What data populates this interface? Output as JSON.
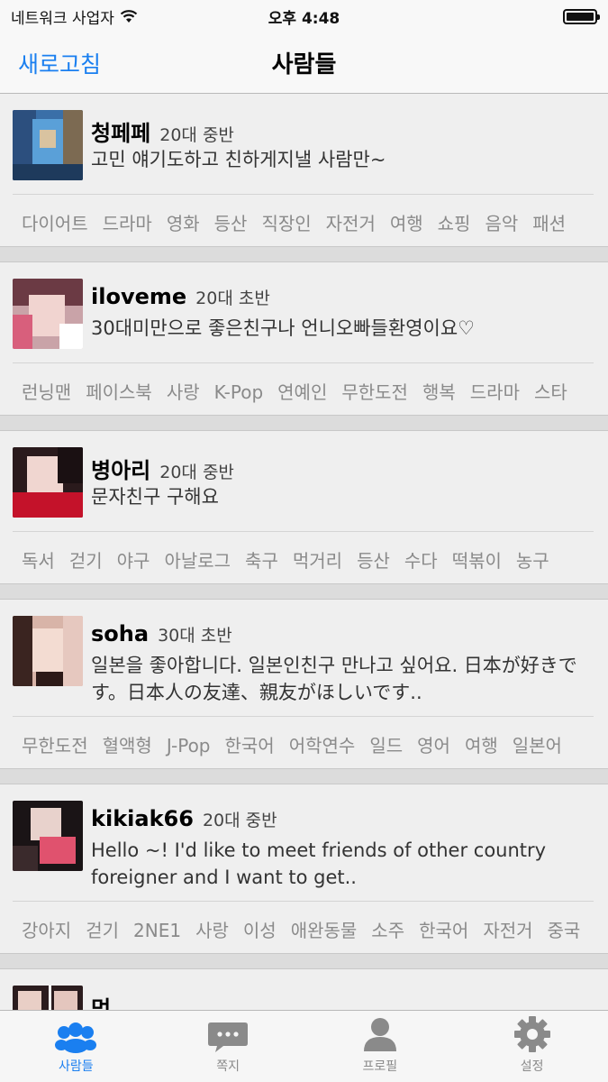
{
  "status_bar": {
    "carrier": "네트워크 사업자",
    "time": "오후 4:48"
  },
  "nav": {
    "left_button": "새로고침",
    "title": "사람들"
  },
  "people": [
    {
      "name": "청페페",
      "age": "20대 중반",
      "message": "고민 얘기도하고 친하게지낼 사람만~",
      "tags": [
        "다이어트",
        "드라마",
        "영화",
        "등산",
        "직장인",
        "자전거",
        "여행",
        "쇼핑",
        "음악",
        "패션"
      ]
    },
    {
      "name": "iloveme",
      "age": "20대 초반",
      "message": "30대미만으로 좋은친구나 언니오빠들환영이요♡",
      "tags": [
        "런닝맨",
        "페이스북",
        "사랑",
        "K-Pop",
        "연예인",
        "무한도전",
        "행복",
        "드라마",
        "스타"
      ]
    },
    {
      "name": "병아리",
      "age": "20대 중반",
      "message": "문자친구 구해요",
      "tags": [
        "독서",
        "걷기",
        "야구",
        "아날로그",
        "축구",
        "먹거리",
        "등산",
        "수다",
        "떡볶이",
        "농구"
      ]
    },
    {
      "name": "soha",
      "age": "30대 초반",
      "message": "일본을 좋아합니다. 일본인친구 만나고 싶어요. 日本が好きです。日本人の友達、親友がほしいです..",
      "tags": [
        "무한도전",
        "혈액형",
        "J-Pop",
        "한국어",
        "어학연수",
        "일드",
        "영어",
        "여행",
        "일본어"
      ]
    },
    {
      "name": "kikiak66",
      "age": "20대 중반",
      "message": "Hello ~! I'd like to meet friends of other country foreigner and I want to get..",
      "tags": [
        "강아지",
        "걷기",
        "2NE1",
        "사랑",
        "이성",
        "애완동물",
        "소주",
        "한국어",
        "자전거",
        "중국"
      ]
    },
    {
      "name": "멍",
      "age": "",
      "message": "",
      "tags": []
    }
  ],
  "tabs": [
    {
      "label": "사람들",
      "icon": "people-icon",
      "active": true
    },
    {
      "label": "쪽지",
      "icon": "message-bubble-icon",
      "active": false
    },
    {
      "label": "프로필",
      "icon": "profile-icon",
      "active": false
    },
    {
      "label": "설정",
      "icon": "gear-icon",
      "active": false
    }
  ],
  "colors": {
    "accent": "#1a7ff0",
    "tab_inactive": "#8a8a8a"
  }
}
